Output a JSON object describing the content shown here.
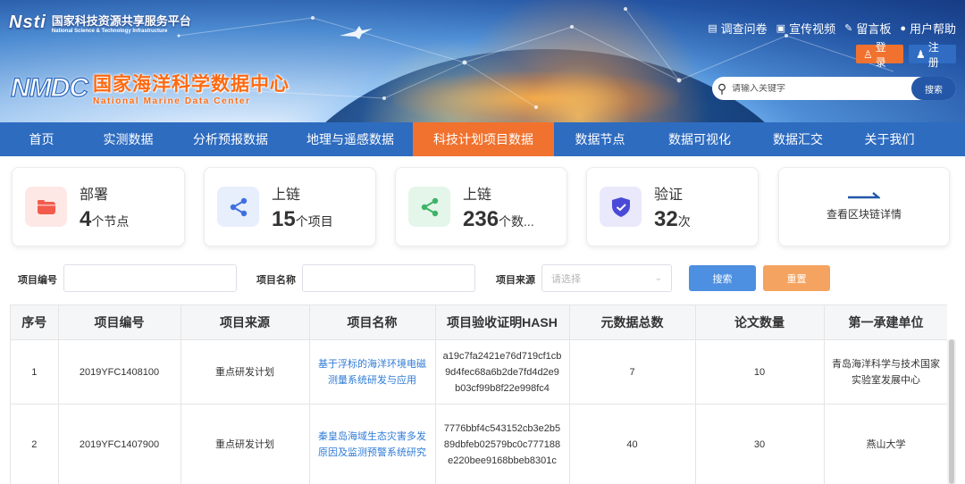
{
  "header": {
    "nsti_logo": "Nsti",
    "platform_cn": "国家科技资源共享服务平台",
    "platform_en": "National Science & Technology Infrastructure",
    "nmdc_logo": "NMDC",
    "center_cn": "国家海洋科学数据中心",
    "center_en": "National Marine Data Center",
    "top_links": [
      {
        "label": "调查问卷",
        "icon": "survey-icon"
      },
      {
        "label": "宣传视频",
        "icon": "video-icon"
      },
      {
        "label": "留言板",
        "icon": "message-icon"
      },
      {
        "label": "用户帮助",
        "icon": "help-icon"
      }
    ],
    "login_label": "登录",
    "register_label": "注册",
    "search_placeholder": "请输入关键字",
    "search_button": "搜索"
  },
  "nav": {
    "items": [
      "首页",
      "实测数据",
      "分析预报数据",
      "地理与遥感数据",
      "科技计划项目数据",
      "数据节点",
      "数据可视化",
      "数据汇交",
      "关于我们"
    ],
    "active_index": 4
  },
  "stats": [
    {
      "label": "部署",
      "number": "4",
      "unit": "个节点",
      "icon": "folder-icon",
      "color": "#f25b4c",
      "bg": "#fde8e6"
    },
    {
      "label": "上链",
      "number": "15",
      "unit": "个项目",
      "icon": "share-nodes-icon",
      "color": "#3e6fe0",
      "bg": "#e7eefc"
    },
    {
      "label": "上链",
      "number": "236",
      "unit": "个数...",
      "icon": "share-nodes-icon",
      "color": "#3fb368",
      "bg": "#e4f6ea"
    },
    {
      "label": "验证",
      "number": "32",
      "unit": "次",
      "icon": "shield-check-icon",
      "color": "#4a4ad8",
      "bg": "#e9e9fb"
    }
  ],
  "chain_details": "查看区块链详情",
  "filter": {
    "project_no_label": "项目编号",
    "project_no_value": "",
    "project_name_label": "项目名称",
    "project_name_value": "",
    "source_label": "项目来源",
    "source_placeholder": "请选择",
    "search_button": "搜索",
    "reset_button": "重置",
    "search_color": "#4d8fe0",
    "reset_color": "#f4a460"
  },
  "table": {
    "headers": [
      "序号",
      "项目编号",
      "项目来源",
      "项目名称",
      "项目验收证明HASH",
      "元数据总数",
      "论文数量",
      "第一承建单位"
    ],
    "rows": [
      {
        "no": "1",
        "code": "2019YFC1408100",
        "source": "重点研发计划",
        "name": "基于浮标的海洋环境电磁测量系统研发与应用",
        "hash": "a19c7fa2421e76d719cf1cb9d4fec68a6b2de7fd4d2e9b03cf99b8f22e998fc4",
        "meta": "7",
        "papers": "10",
        "unit": "青岛海洋科学与技术国家实验室发展中心"
      },
      {
        "no": "2",
        "code": "2019YFC1407900",
        "source": "重点研发计划",
        "name": "秦皇岛海域生态灾害多发原因及监测预警系统研究",
        "hash": "7776bbf4c543152cb3e2b589dbfeb02579bc0c777188e220bee9168bbeb8301c",
        "meta": "40",
        "papers": "30",
        "unit": "燕山大学"
      }
    ]
  }
}
